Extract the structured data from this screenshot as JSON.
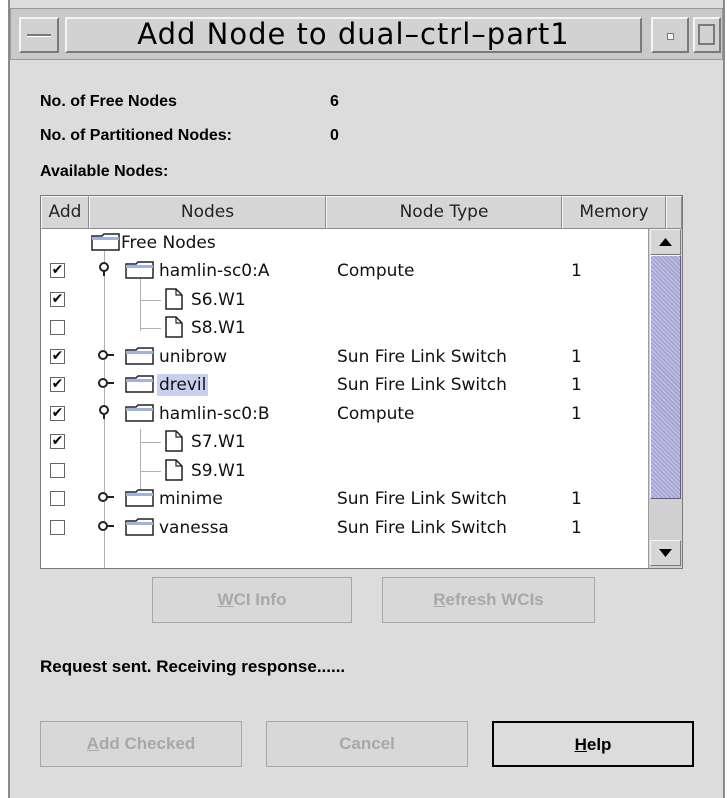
{
  "window": {
    "title": "Add Node to dual–ctrl–part1"
  },
  "summary": {
    "free_label": "No. of Free Nodes",
    "free_value": "6",
    "partitioned_label": "No. of Partitioned Nodes:",
    "partitioned_value": "0",
    "available_label": "Available Nodes:"
  },
  "table": {
    "columns": [
      "Add",
      "Nodes",
      "Node Type",
      "Memory"
    ],
    "root_label": "Free Nodes",
    "rows": [
      {
        "checked": "✔",
        "name": "hamlin-sc0:A",
        "type": "Compute",
        "memory": "1"
      },
      {
        "checked": "✔",
        "name": "S6.W1",
        "type": "",
        "memory": ""
      },
      {
        "checked": "",
        "name": "S8.W1",
        "type": "",
        "memory": ""
      },
      {
        "checked": "✔",
        "name": "unibrow",
        "type": "Sun Fire Link Switch",
        "memory": "1"
      },
      {
        "checked": "✔",
        "name": "drevil",
        "type": "Sun Fire Link Switch",
        "memory": "1"
      },
      {
        "checked": "✔",
        "name": "hamlin-sc0:B",
        "type": "Compute",
        "memory": "1"
      },
      {
        "checked": "✔",
        "name": "S7.W1",
        "type": "",
        "memory": ""
      },
      {
        "checked": "",
        "name": "S9.W1",
        "type": "",
        "memory": ""
      },
      {
        "checked": "",
        "name": "minime",
        "type": "Sun Fire Link Switch",
        "memory": "1"
      },
      {
        "checked": "",
        "name": "vanessa",
        "type": "Sun Fire Link Switch",
        "memory": "1"
      }
    ]
  },
  "buttons": {
    "wci_info": "WCI Info",
    "refresh_wcis": "Refresh WCIs",
    "add_checked": "Add Checked",
    "cancel": "Cancel",
    "help": "Help"
  },
  "status": "Request sent. Receiving response......"
}
